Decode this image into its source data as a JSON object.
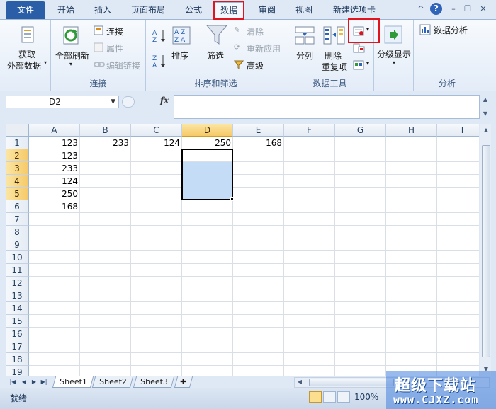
{
  "tabs": [
    "文件",
    "开始",
    "插入",
    "页面布局",
    "公式",
    "数据",
    "审阅",
    "视图",
    "新建选项卡"
  ],
  "active_tab": "数据",
  "window_controls": [
    "minimize-ribbon",
    "help",
    "minimize",
    "restore",
    "close"
  ],
  "ribbon": {
    "get_external": {
      "line1": "获取",
      "line2": "外部数据"
    },
    "refresh_all": "全部刷新",
    "connections": "连接",
    "properties": "属性",
    "edit_links": "编辑链接",
    "connections_group": "连接",
    "sort_asc": "A→Z",
    "sort_desc": "Z→A",
    "sort": "排序",
    "filter": "筛选",
    "clear": "清除",
    "reapply": "重新应用",
    "advanced": "高级",
    "sort_filter_group": "排序和筛选",
    "text_to_columns": "分列",
    "remove_duplicates": {
      "line1": "删除",
      "line2": "重复项"
    },
    "data_tools_group": "数据工具",
    "outline": "分级显示",
    "data_analysis": "数据分析",
    "analysis_group": "分析"
  },
  "formula_bar": {
    "name_box": "D2",
    "fx": "fx",
    "content": ""
  },
  "grid": {
    "columns": [
      "A",
      "B",
      "C",
      "D",
      "E",
      "F",
      "G",
      "H",
      "I"
    ],
    "selected_column": "D",
    "rows": [
      "1",
      "2",
      "3",
      "4",
      "5",
      "6",
      "7",
      "8",
      "9",
      "10",
      "11",
      "12",
      "13",
      "14",
      "15",
      "16",
      "17",
      "18",
      "19"
    ],
    "selected_rows": [
      "2",
      "3",
      "4",
      "5"
    ],
    "cells": {
      "A1": "123",
      "B1": "233",
      "C1": "124",
      "D1": "250",
      "E1": "168",
      "A2": "123",
      "A3": "233",
      "A4": "124",
      "A5": "250",
      "A6": "168"
    }
  },
  "sheets": [
    "Sheet1",
    "Sheet2",
    "Sheet3"
  ],
  "active_sheet": "Sheet1",
  "status": {
    "ready": "就绪",
    "zoom": "100%"
  },
  "watermark": {
    "line1": "超级下载站",
    "line2": "www.CJXZ.com"
  },
  "colors": {
    "file_tab": "#2a5fa8",
    "highlight": "#e0141e",
    "selection": "#c4dcf6",
    "header_selected": "#f6c967"
  }
}
